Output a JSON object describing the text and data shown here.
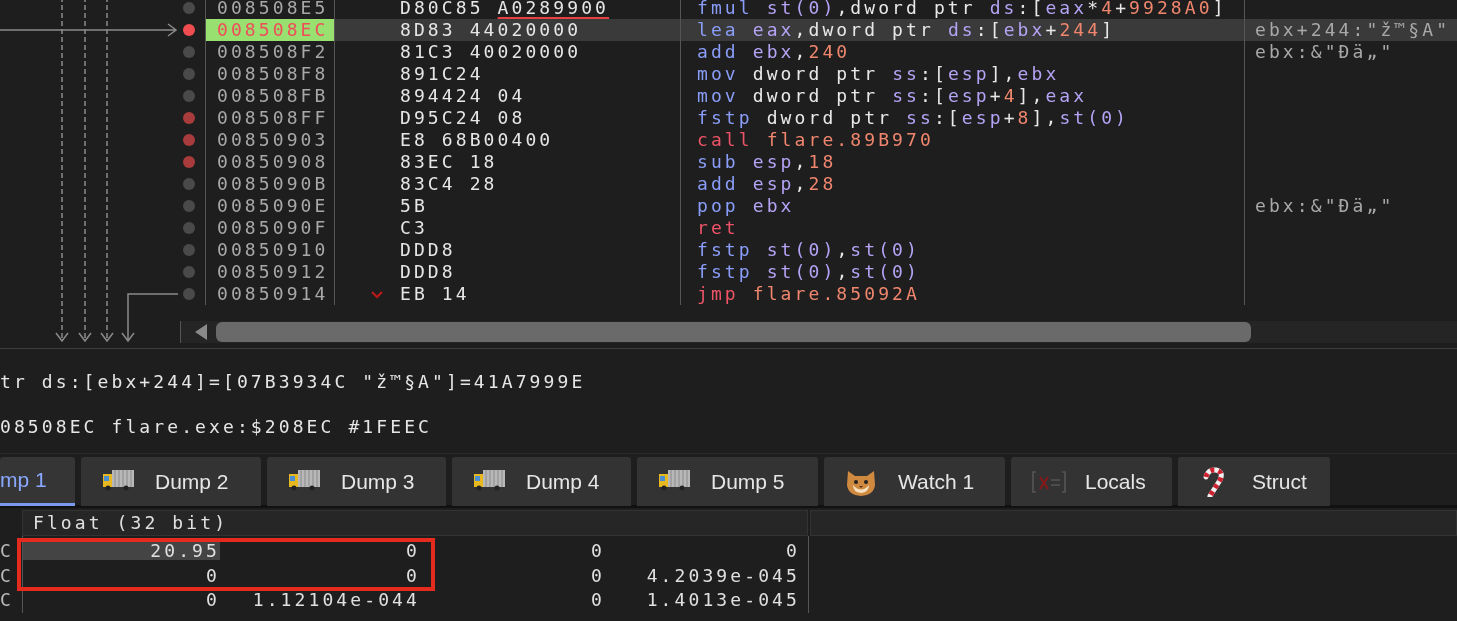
{
  "disassembly": {
    "rows": [
      {
        "address": "008508E5",
        "breakpoint": false,
        "current": false,
        "jump_marker": false,
        "bytes": [
          {
            "text": "D80C85",
            "relocation": false
          },
          {
            "text": "A0289900",
            "relocation": true
          }
        ],
        "mnemonic": {
          "kind": "op",
          "text": "fmul"
        },
        "operands": [
          {
            "kind": "reg",
            "text": "st(0)"
          },
          {
            "kind": "plain",
            "text": ",dword ptr"
          },
          {
            "kind": "reg",
            "text": "ds"
          },
          {
            "kind": "plain",
            "text": ":["
          },
          {
            "kind": "reg",
            "text": "eax"
          },
          {
            "kind": "plain",
            "text": "*"
          },
          {
            "kind": "num",
            "text": "4"
          },
          {
            "kind": "plain",
            "text": "+"
          },
          {
            "kind": "num",
            "text": "9928A0"
          },
          {
            "kind": "plain",
            "text": "]"
          }
        ]
      },
      {
        "address": "008508EC",
        "breakpoint": true,
        "current": true,
        "jump_marker": false,
        "bytes": [
          {
            "text": "8D83",
            "relocation": false
          },
          {
            "text": "44020000",
            "relocation": false
          }
        ],
        "mnemonic": {
          "kind": "op",
          "text": "lea"
        },
        "operands": [
          {
            "kind": "reg",
            "text": "eax"
          },
          {
            "kind": "plain",
            "text": ",dword ptr"
          },
          {
            "kind": "reg",
            "text": "ds"
          },
          {
            "kind": "plain",
            "text": ":["
          },
          {
            "kind": "reg",
            "text": "ebx"
          },
          {
            "kind": "plain",
            "text": "+"
          },
          {
            "kind": "num",
            "text": "244"
          },
          {
            "kind": "plain",
            "text": "]"
          }
        ],
        "comment": "ebx+244:\"ž™§A\""
      },
      {
        "address": "008508F2",
        "breakpoint": false,
        "current": false,
        "jump_marker": false,
        "bytes": [
          {
            "text": "81C3",
            "relocation": false
          },
          {
            "text": "40020000",
            "relocation": false
          }
        ],
        "mnemonic": {
          "kind": "op",
          "text": "add"
        },
        "operands": [
          {
            "kind": "reg",
            "text": "ebx"
          },
          {
            "kind": "plain",
            "text": ","
          },
          {
            "kind": "num",
            "text": "240"
          }
        ],
        "comment": "ebx:&\"Đä„\""
      },
      {
        "address": "008508F8",
        "breakpoint": false,
        "current": false,
        "jump_marker": false,
        "bytes": [
          {
            "text": "891C24",
            "relocation": false
          }
        ],
        "mnemonic": {
          "kind": "op",
          "text": "mov"
        },
        "operands": [
          {
            "kind": "plain",
            "text": "dword ptr"
          },
          {
            "kind": "reg",
            "text": "ss"
          },
          {
            "kind": "plain",
            "text": ":["
          },
          {
            "kind": "reg",
            "text": "esp"
          },
          {
            "kind": "plain",
            "text": "],"
          },
          {
            "kind": "reg",
            "text": "ebx"
          }
        ]
      },
      {
        "address": "008508FB",
        "breakpoint": false,
        "current": false,
        "jump_marker": false,
        "bytes": [
          {
            "text": "894424",
            "relocation": false
          },
          {
            "text": "04",
            "relocation": false
          }
        ],
        "mnemonic": {
          "kind": "op",
          "text": "mov"
        },
        "operands": [
          {
            "kind": "plain",
            "text": "dword ptr"
          },
          {
            "kind": "reg",
            "text": "ss"
          },
          {
            "kind": "plain",
            "text": ":["
          },
          {
            "kind": "reg",
            "text": "esp"
          },
          {
            "kind": "plain",
            "text": "+"
          },
          {
            "kind": "num",
            "text": "4"
          },
          {
            "kind": "plain",
            "text": "],"
          },
          {
            "kind": "reg",
            "text": "eax"
          }
        ]
      },
      {
        "address": "008508FF",
        "breakpoint": true,
        "current": false,
        "jump_marker": false,
        "bytes": [
          {
            "text": "D95C24",
            "relocation": false
          },
          {
            "text": "08",
            "relocation": false
          }
        ],
        "mnemonic": {
          "kind": "op",
          "text": "fstp"
        },
        "operands": [
          {
            "kind": "plain",
            "text": "dword ptr"
          },
          {
            "kind": "reg",
            "text": "ss"
          },
          {
            "kind": "plain",
            "text": ":["
          },
          {
            "kind": "reg",
            "text": "esp"
          },
          {
            "kind": "plain",
            "text": "+"
          },
          {
            "kind": "num",
            "text": "8"
          },
          {
            "kind": "plain",
            "text": "],"
          },
          {
            "kind": "reg",
            "text": "st(0)"
          }
        ]
      },
      {
        "address": "00850903",
        "breakpoint": true,
        "current": false,
        "jump_marker": false,
        "bytes": [
          {
            "text": "E8",
            "relocation": false
          },
          {
            "text": "68B00400",
            "relocation": false
          }
        ],
        "mnemonic": {
          "kind": "branch",
          "text": "call"
        },
        "operands": [
          {
            "kind": "num",
            "text": "flare.89B970"
          }
        ]
      },
      {
        "address": "00850908",
        "breakpoint": true,
        "current": false,
        "jump_marker": false,
        "bytes": [
          {
            "text": "83EC",
            "relocation": false
          },
          {
            "text": "18",
            "relocation": false
          }
        ],
        "mnemonic": {
          "kind": "op",
          "text": "sub"
        },
        "operands": [
          {
            "kind": "reg",
            "text": "esp"
          },
          {
            "kind": "plain",
            "text": ","
          },
          {
            "kind": "num",
            "text": "18"
          }
        ]
      },
      {
        "address": "0085090B",
        "breakpoint": false,
        "current": false,
        "jump_marker": false,
        "bytes": [
          {
            "text": "83C4",
            "relocation": false
          },
          {
            "text": "28",
            "relocation": false
          }
        ],
        "mnemonic": {
          "kind": "op",
          "text": "add"
        },
        "operands": [
          {
            "kind": "reg",
            "text": "esp"
          },
          {
            "kind": "plain",
            "text": ","
          },
          {
            "kind": "num",
            "text": "28"
          }
        ]
      },
      {
        "address": "0085090E",
        "breakpoint": false,
        "current": false,
        "jump_marker": false,
        "bytes": [
          {
            "text": "5B",
            "relocation": false
          }
        ],
        "mnemonic": {
          "kind": "op",
          "text": "pop"
        },
        "operands": [
          {
            "kind": "reg",
            "text": "ebx"
          }
        ],
        "comment": "ebx:&\"Đä„\""
      },
      {
        "address": "0085090F",
        "breakpoint": false,
        "current": false,
        "jump_marker": false,
        "bytes": [
          {
            "text": "C3",
            "relocation": false
          }
        ],
        "mnemonic": {
          "kind": "branch",
          "text": "ret"
        },
        "operands": []
      },
      {
        "address": "00850910",
        "breakpoint": false,
        "current": false,
        "jump_marker": false,
        "bytes": [
          {
            "text": "DDD8",
            "relocation": false
          }
        ],
        "mnemonic": {
          "kind": "op",
          "text": "fstp"
        },
        "operands": [
          {
            "kind": "reg",
            "text": "st(0)"
          },
          {
            "kind": "plain",
            "text": ","
          },
          {
            "kind": "reg",
            "text": "st(0)"
          }
        ]
      },
      {
        "address": "00850912",
        "breakpoint": false,
        "current": false,
        "jump_marker": false,
        "bytes": [
          {
            "text": "DDD8",
            "relocation": false
          }
        ],
        "mnemonic": {
          "kind": "op",
          "text": "fstp"
        },
        "operands": [
          {
            "kind": "reg",
            "text": "st(0)"
          },
          {
            "kind": "plain",
            "text": ","
          },
          {
            "kind": "reg",
            "text": "st(0)"
          }
        ]
      },
      {
        "address": "00850914",
        "breakpoint": false,
        "current": false,
        "jump_marker": true,
        "bytes": [
          {
            "text": "EB",
            "relocation": false
          },
          {
            "text": "14",
            "relocation": false
          }
        ],
        "mnemonic": {
          "kind": "branch",
          "text": "jmp"
        },
        "operands": [
          {
            "kind": "num",
            "text": "flare.85092A"
          }
        ]
      }
    ]
  },
  "info_lines": [
    "tr ds:[ebx+244]=[07B3934C \"ž™§A\"]=41A7999E",
    "08508EC flare.exe:$208EC #1FEEC"
  ],
  "tabs": [
    {
      "label": "mp 1",
      "kind": "plain",
      "selected": true
    },
    {
      "label": "Dump 2",
      "kind": "dump",
      "selected": false
    },
    {
      "label": "Dump 3",
      "kind": "dump",
      "selected": false
    },
    {
      "label": "Dump 4",
      "kind": "dump",
      "selected": false
    },
    {
      "label": "Dump 5",
      "kind": "dump",
      "selected": false
    },
    {
      "label": "Watch 1",
      "kind": "watch",
      "selected": false
    },
    {
      "label": "Locals",
      "kind": "locals",
      "selected": false
    },
    {
      "label": "Struct",
      "kind": "struct",
      "selected": false
    }
  ],
  "dump": {
    "header": "Float (32 bit)",
    "rows": [
      {
        "address": "C",
        "values": [
          {
            "text": "20.95",
            "selected": true
          },
          {
            "text": "0",
            "selected": false
          },
          {
            "text": "0",
            "selected": false
          },
          {
            "text": "0",
            "selected": false
          }
        ]
      },
      {
        "address": "C",
        "values": [
          {
            "text": "0",
            "selected": false
          },
          {
            "text": "0",
            "selected": false
          },
          {
            "text": "0",
            "selected": false
          },
          {
            "text": "4.2039e-045",
            "selected": false
          }
        ]
      },
      {
        "address": "C",
        "values": [
          {
            "text": "0",
            "selected": false
          },
          {
            "text": "1.12104e-044",
            "selected": false
          },
          {
            "text": "0",
            "selected": false
          },
          {
            "text": "1.4013e-045",
            "selected": false
          }
        ]
      }
    ]
  }
}
